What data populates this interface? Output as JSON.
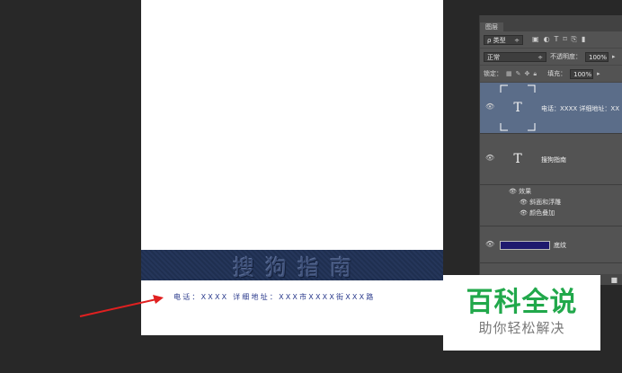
{
  "document": {
    "banner_text": "搜狗指南",
    "contact_text": "电话：XXXX  详细地址：XXX市XXXX街XXX路"
  },
  "layers_panel": {
    "tab_label": "图层",
    "filter": {
      "kind": "ρ 类型",
      "stepper": "÷"
    },
    "blend_mode": {
      "value": "正常",
      "stepper": "÷"
    },
    "opacity": {
      "label": "不透明度：",
      "value": "100%"
    },
    "lock": {
      "label": "锁定："
    },
    "fill": {
      "label": "填充：",
      "value": "100%"
    },
    "layers": [
      {
        "name": "电话：XXXX 详细地址：XX",
        "type": "text",
        "selected": true
      },
      {
        "name": "搜狗指南",
        "type": "text",
        "selected": false,
        "effects_label": "效果",
        "effects": [
          "斜面和浮雕",
          "颜色叠加"
        ]
      },
      {
        "name": "底纹",
        "type": "shape",
        "selected": false
      }
    ]
  },
  "watermark": {
    "brand": "百科全说",
    "tagline": "助你轻松解决"
  },
  "colors": {
    "canvas_bg": "#282828",
    "banner": "#25365a",
    "contact_text": "#2a3a8c",
    "arrow": "#e02020",
    "panel_bg": "#535353",
    "selected_layer": "#5b6d89",
    "brand_green": "#21a84b"
  }
}
